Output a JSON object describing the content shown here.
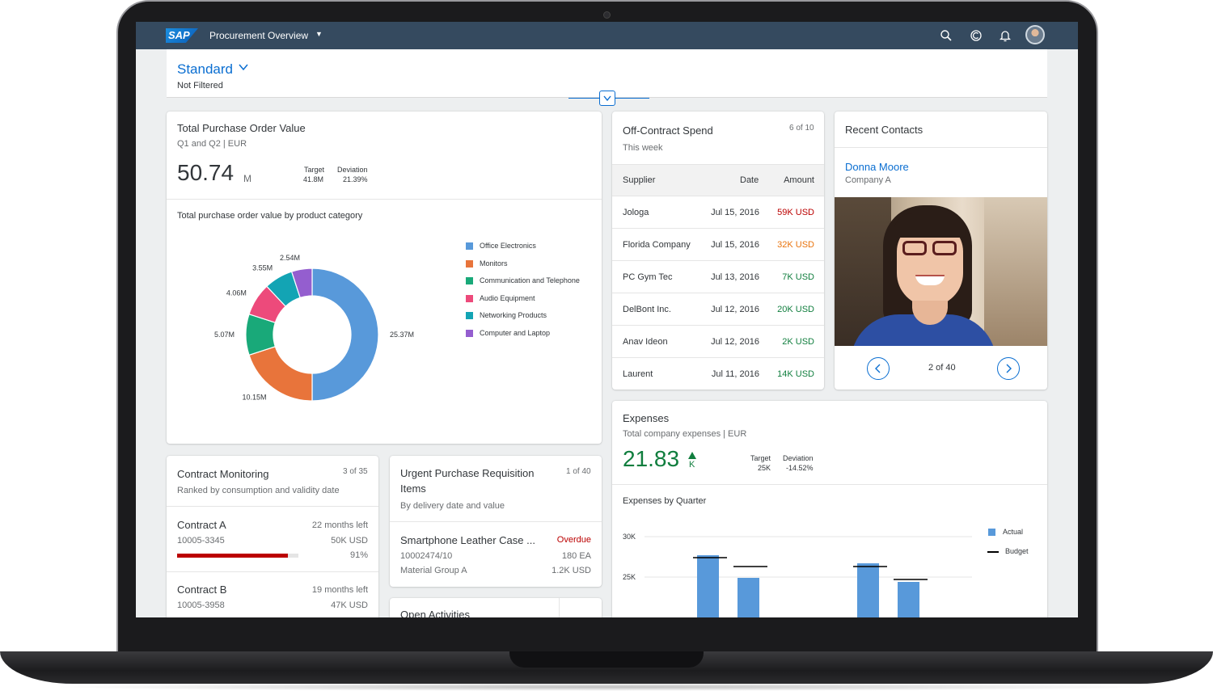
{
  "shell": {
    "logo_text": "SAP",
    "app_title": "Procurement Overview",
    "icons": [
      "search-icon",
      "copilot-icon",
      "bell-icon",
      "avatar"
    ]
  },
  "header": {
    "variant": "Standard",
    "filter_status": "Not Filtered"
  },
  "purchase_order": {
    "title": "Total Purchase Order Value",
    "subtitle": "Q1 and Q2 | EUR",
    "kpi_value": "50.74",
    "kpi_unit": "M",
    "target_label": "Target",
    "target_value": "41.8M",
    "deviation_label": "Deviation",
    "deviation_value": "21.39%",
    "chart_title": "Total purchase order value by product category"
  },
  "chart_data": [
    {
      "type": "pie",
      "title": "Total purchase order value by product category",
      "categories": [
        "Office Electronics",
        "Monitors",
        "Communication and Telephone",
        "Audio Equipment",
        "Networking Products",
        "Computer and Laptop"
      ],
      "values": [
        25.37,
        10.15,
        5.07,
        4.06,
        3.55,
        2.54
      ],
      "value_labels": [
        "25.37M",
        "10.15M",
        "5.07M",
        "4.06M",
        "3.55M",
        "2.54M"
      ],
      "colors": [
        "#5899da",
        "#e8743b",
        "#19a979",
        "#ed4a7b",
        "#13a4b4",
        "#945ecf"
      ],
      "legend": "right",
      "donut": true
    },
    {
      "type": "bar",
      "title": "Expenses by Quarter",
      "series": [
        {
          "name": "Actual",
          "values": [
            27.7,
            24.9,
            26.7,
            24.4
          ]
        },
        {
          "name": "Budget",
          "values": [
            27.4,
            26.3,
            26.3,
            24.7
          ]
        }
      ],
      "y_ticks": [
        "30K",
        "25K"
      ],
      "ylim": [
        23,
        31
      ],
      "colors": [
        "#5899da",
        "#000000"
      ],
      "legend": "right"
    }
  ],
  "off_contract": {
    "title": "Off-Contract Spend",
    "subtitle": "This week",
    "count": "6 of 10",
    "columns": [
      "Supplier",
      "Date",
      "Amount"
    ],
    "rows": [
      {
        "supplier": "Jologa",
        "date": "Jul 15, 2016",
        "amount": "59K USD",
        "color": "#bb0000"
      },
      {
        "supplier": "Florida Company",
        "date": "Jul 15, 2016",
        "amount": "32K USD",
        "color": "#e9730c"
      },
      {
        "supplier": "PC Gym Tec",
        "date": "Jul 13, 2016",
        "amount": "7K USD",
        "color": "#107e3e"
      },
      {
        "supplier": "DelBont Inc.",
        "date": "Jul 12, 2016",
        "amount": "20K USD",
        "color": "#107e3e"
      },
      {
        "supplier": "Anav Ideon",
        "date": "Jul 12, 2016",
        "amount": "2K USD",
        "color": "#107e3e"
      },
      {
        "supplier": "Laurent",
        "date": "Jul 11, 2016",
        "amount": "14K USD",
        "color": "#107e3e"
      }
    ]
  },
  "contacts": {
    "title": "Recent Contacts",
    "name": "Donna Moore",
    "company": "Company A",
    "pager": "2 of 40"
  },
  "expenses": {
    "title": "Expenses",
    "subtitle": "Total company expenses | EUR",
    "kpi_value": "21.83",
    "kpi_unit": "K",
    "target_label": "Target",
    "target_value": "25K",
    "deviation_label": "Deviation",
    "deviation_value": "-14.52%",
    "chart_title": "Expenses by Quarter",
    "legend_actual": "Actual",
    "legend_budget": "Budget",
    "kpi_color": "#107e3e"
  },
  "contract_monitoring": {
    "title": "Contract Monitoring",
    "subtitle": "Ranked by consumption and validity date",
    "count": "3 of 35",
    "items": [
      {
        "name": "Contract A",
        "id": "10005-3345",
        "remaining": "22 months left",
        "value": "50K USD",
        "percent": "91%",
        "progress": 0.91
      },
      {
        "name": "Contract B",
        "id": "10005-3958",
        "remaining": "19 months left",
        "value": "47K USD"
      }
    ]
  },
  "urgent_pr": {
    "title_line1": "Urgent Purchase Requisition",
    "title_line2": "Items",
    "subtitle": "By delivery date and value",
    "count": "1 of 40",
    "item_name": "Smartphone Leather Case ...",
    "item_status": "Overdue",
    "item_id": "10002474/10",
    "item_qty": "180 EA",
    "item_group": "Material Group A",
    "item_value": "1.2K USD"
  },
  "open_activities": {
    "title": "Open Activities"
  }
}
